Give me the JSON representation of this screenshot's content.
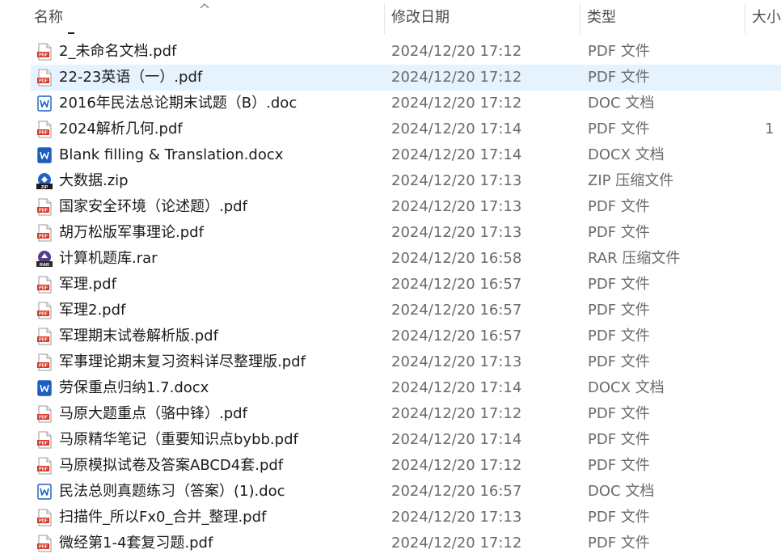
{
  "header": {
    "col_name": "名称",
    "col_date": "修改日期",
    "col_type": "类型",
    "col_size": "大小"
  },
  "files": [
    {
      "name": "2_未命名文档.pdf",
      "date": "2024/12/20 17:12",
      "type": "PDF 文件",
      "size": "",
      "icon": "pdf-icon"
    },
    {
      "name": "22-23英语（一）.pdf",
      "date": "2024/12/20 17:12",
      "type": "PDF 文件",
      "size": "",
      "icon": "pdf-icon",
      "selected": true
    },
    {
      "name": "2016年民法总论期末试题（B）.doc",
      "date": "2024/12/20 17:12",
      "type": "DOC 文档",
      "size": "",
      "icon": "word-doc-icon"
    },
    {
      "name": "2024解析几何.pdf",
      "date": "2024/12/20 17:14",
      "type": "PDF 文件",
      "size": "1",
      "icon": "pdf-icon"
    },
    {
      "name": "Blank filling & Translation.docx",
      "date": "2024/12/20 17:14",
      "type": "DOCX 文档",
      "size": "",
      "icon": "word-docx-icon"
    },
    {
      "name": "大数据.zip",
      "date": "2024/12/20 17:13",
      "type": "ZIP 压缩文件",
      "size": "",
      "icon": "zip-icon"
    },
    {
      "name": "国家安全环境（论述题）.pdf",
      "date": "2024/12/20 17:13",
      "type": "PDF 文件",
      "size": "",
      "icon": "pdf-icon"
    },
    {
      "name": "胡万松版军事理论.pdf",
      "date": "2024/12/20 17:13",
      "type": "PDF 文件",
      "size": "",
      "icon": "pdf-icon"
    },
    {
      "name": "计算机题库.rar",
      "date": "2024/12/20 16:58",
      "type": "RAR 压缩文件",
      "size": "",
      "icon": "rar-icon"
    },
    {
      "name": "军理.pdf",
      "date": "2024/12/20 16:57",
      "type": "PDF 文件",
      "size": "",
      "icon": "pdf-icon"
    },
    {
      "name": "军理2.pdf",
      "date": "2024/12/20 16:57",
      "type": "PDF 文件",
      "size": "",
      "icon": "pdf-icon"
    },
    {
      "name": "军理期末试卷解析版.pdf",
      "date": "2024/12/20 16:57",
      "type": "PDF 文件",
      "size": "",
      "icon": "pdf-icon"
    },
    {
      "name": "军事理论期末复习资料详尽整理版.pdf",
      "date": "2024/12/20 17:13",
      "type": "PDF 文件",
      "size": "",
      "icon": "pdf-icon"
    },
    {
      "name": "劳保重点归纳1.7.docx",
      "date": "2024/12/20 17:14",
      "type": "DOCX 文档",
      "size": "",
      "icon": "word-docx-icon"
    },
    {
      "name": "马原大题重点（骆中锋）.pdf",
      "date": "2024/12/20 17:12",
      "type": "PDF 文件",
      "size": "",
      "icon": "pdf-icon"
    },
    {
      "name": "马原精华笔记（重要知识点bybb.pdf",
      "date": "2024/12/20 17:14",
      "type": "PDF 文件",
      "size": "",
      "icon": "pdf-icon"
    },
    {
      "name": "马原模拟试卷及答案ABCD4套.pdf",
      "date": "2024/12/20 17:12",
      "type": "PDF 文件",
      "size": "",
      "icon": "pdf-icon"
    },
    {
      "name": "民法总则真题练习（答案）(1).doc",
      "date": "2024/12/20 16:57",
      "type": "DOC 文档",
      "size": "",
      "icon": "word-doc-icon"
    },
    {
      "name": "扫描件_所以Fx0_合并_整理.pdf",
      "date": "2024/12/20 17:13",
      "type": "PDF 文件",
      "size": "",
      "icon": "pdf-icon"
    },
    {
      "name": "微经第1-4套复习题.pdf",
      "date": "2024/12/20 17:12",
      "type": "PDF 文件",
      "size": "",
      "icon": "pdf-icon"
    }
  ],
  "colors": {
    "selection": "#e5f3ff",
    "pdf_red": "#d9372a",
    "word_blue": "#1b5ebe",
    "zip_blue": "#1f63c6",
    "rar_purple": "#5a3d8a"
  }
}
